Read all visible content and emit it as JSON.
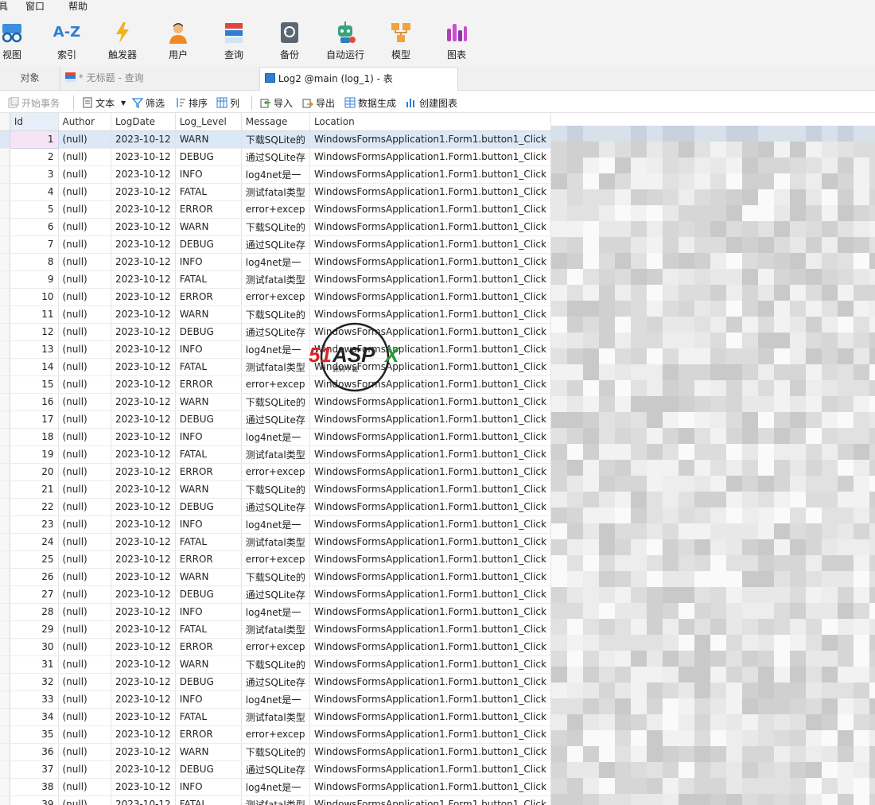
{
  "menubar": {
    "items": [
      "具",
      "窗口",
      "帮助"
    ]
  },
  "ribbon": {
    "buttons": [
      {
        "label": "视图",
        "icon": "view-icon"
      },
      {
        "label": "索引",
        "icon": "index-az-icon"
      },
      {
        "label": "触发器",
        "icon": "trigger-icon"
      },
      {
        "label": "用户",
        "icon": "user-icon"
      },
      {
        "label": "查询",
        "icon": "query-icon"
      },
      {
        "label": "备份",
        "icon": "backup-icon"
      },
      {
        "label": "自动运行",
        "icon": "robot-icon"
      },
      {
        "label": "模型",
        "icon": "model-icon"
      },
      {
        "label": "图表",
        "icon": "chart-icon"
      }
    ],
    "index_glyph": "A-Z"
  },
  "tabs": {
    "objects": "对象",
    "query": "* 无标题 - 查询",
    "table": "Log2 @main (log_1) - 表"
  },
  "toolbar": {
    "begin_transaction": "开始事务",
    "text": "文本",
    "filter": "筛选",
    "sort": "排序",
    "columns": "列",
    "import": "导入",
    "export": "导出",
    "data_generation": "数据生成",
    "create_chart": "创建图表"
  },
  "grid": {
    "columns": [
      "Id",
      "Author",
      "LogDate",
      "Log_Level",
      "Message",
      "Location"
    ],
    "author": "(null)",
    "date": "2023-10-12",
    "location": "WindowsFormsApplication1.Form1.button1_Click",
    "levels": [
      "WARN",
      "DEBUG",
      "INFO",
      "FATAL",
      "ERROR"
    ],
    "messages": [
      "下载SQLite的",
      "通过SQLite存",
      "log4net是一",
      "测试fatal类型",
      "error+excep"
    ],
    "row_count": 39,
    "selected_row": 1
  },
  "watermark": {
    "text": "51ASPX",
    "sub": "源码下载"
  },
  "colors": {
    "accent": "#1e73c8",
    "selection": "#dbe8f6",
    "watermark_red": "#d8232a",
    "watermark_green": "#2a9a3a"
  }
}
